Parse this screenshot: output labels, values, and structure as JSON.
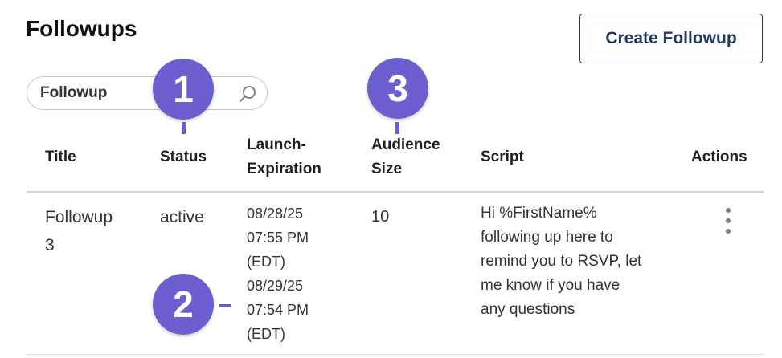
{
  "page": {
    "title": "Followups",
    "create_button_label": "Create Followup"
  },
  "search": {
    "value": "Followup"
  },
  "table": {
    "columns": {
      "title": "Title",
      "status": "Status",
      "launch_line1": "Launch-",
      "launch_line2": "Expiration",
      "audience_line1": "Audience",
      "audience_line2": "Size",
      "script": "Script",
      "actions": "Actions"
    },
    "rows": [
      {
        "title_line1": "Followup",
        "title_line2": "3",
        "status": "active",
        "launch_date": "08/28/25",
        "launch_time": "07:55 PM",
        "launch_tz": "(EDT)",
        "expiration_date": "08/29/25",
        "expiration_time": "07:54 PM",
        "expiration_tz": "(EDT)",
        "audience_size": "10",
        "script_lines": [
          "Hi %FirstName%",
          "following up here to",
          "remind you to RSVP, let",
          "me know if you have",
          "any questions"
        ]
      }
    ]
  },
  "callouts": [
    "1",
    "2",
    "3"
  ],
  "colors": {
    "callout": "#6b5fd0",
    "button_border": "#1f3a5f"
  },
  "icons": {
    "search": "search-icon",
    "actions": "kebab-menu-icon"
  }
}
